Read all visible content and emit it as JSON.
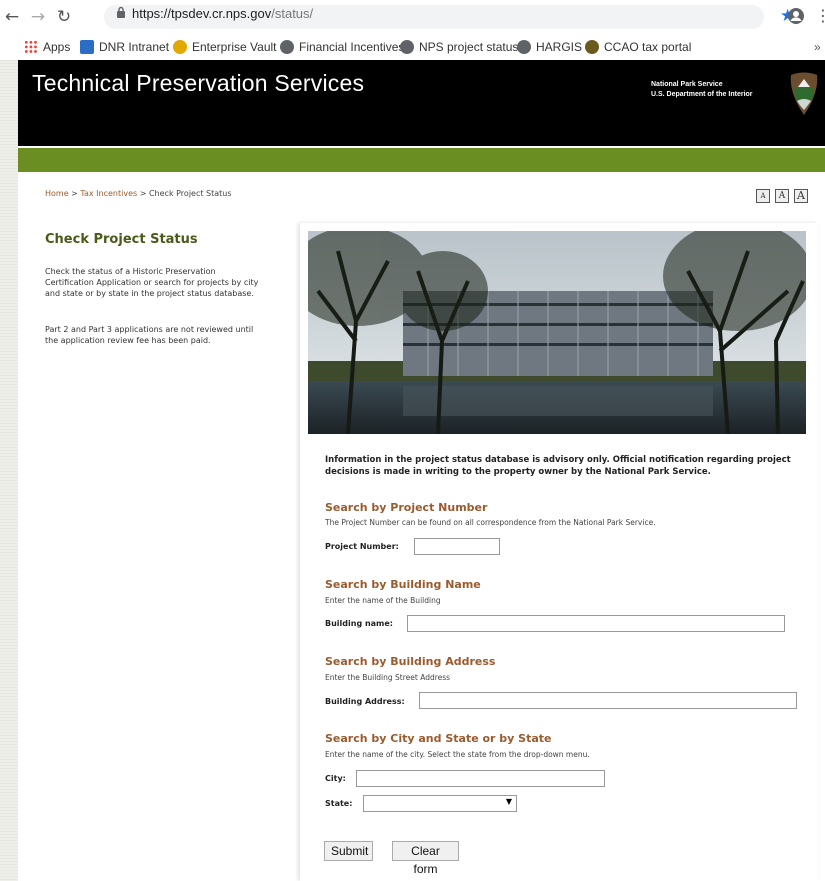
{
  "browser": {
    "url_host": "https://tpsdev.cr.nps.gov",
    "url_path": "/status/",
    "bookmarks": [
      {
        "label": "Apps",
        "color": "#4285f4"
      },
      {
        "label": "DNR Intranet",
        "color": "#2b6cc4"
      },
      {
        "label": "Enterprise Vault",
        "color": "#e0a800"
      },
      {
        "label": "Financial Incentives",
        "color": "#5f6368"
      },
      {
        "label": "NPS project status",
        "color": "#5f6368"
      },
      {
        "label": "HARGIS",
        "color": "#5f6368"
      },
      {
        "label": "CCAO tax portal",
        "color": "#6b5a1e"
      }
    ],
    "overflow": "»"
  },
  "header": {
    "title": "Technical Preservation Services",
    "agency_line1": "National Park Service",
    "agency_line2": "U.S. Department of the Interior"
  },
  "breadcrumb": {
    "home": "Home",
    "sep1": " > ",
    "tax": "Tax Incentives",
    "sep2": " > ",
    "current": "Check Project Status"
  },
  "font_sizes": [
    "A",
    "A",
    "A"
  ],
  "sidebar": {
    "title": "Check Project Status",
    "p1": "Check the status of a Historic Preservation Certification Application or search for projects by city and state or by state in the project status database.",
    "p2": "Part 2 and Part 3 applications are not reviewed until the application review fee has been paid."
  },
  "main": {
    "advisory": "Information in the project status database is advisory only. Official notification regarding project decisions is made in writing to the property owner by the National Park Service.",
    "project": {
      "title": "Search by Project Number",
      "desc": "The Project Number can be found on all correspondence from the National Park Service.",
      "label": "Project Number:",
      "value": ""
    },
    "building_name": {
      "title": "Search by Building Name",
      "desc": "Enter the name of the Building",
      "label": "Building name:",
      "value": ""
    },
    "building_address": {
      "title": "Search by Building Address",
      "desc": "Enter the Building Street Address",
      "label": "Building Address:",
      "value": ""
    },
    "city_state": {
      "title": "Search by City and State or by State",
      "desc": "Enter the name of the city. Select the state from the drop-down menu.",
      "city_label": "City:",
      "city_value": "",
      "state_label": "State:",
      "state_value": ""
    },
    "submit": "Submit",
    "clear": "Clear form"
  },
  "colors": {
    "header_bg": "#000000",
    "green_bar": "#6b8e23",
    "section_title": "#9a5b2f",
    "sidebar_title": "#4a5a1a"
  }
}
